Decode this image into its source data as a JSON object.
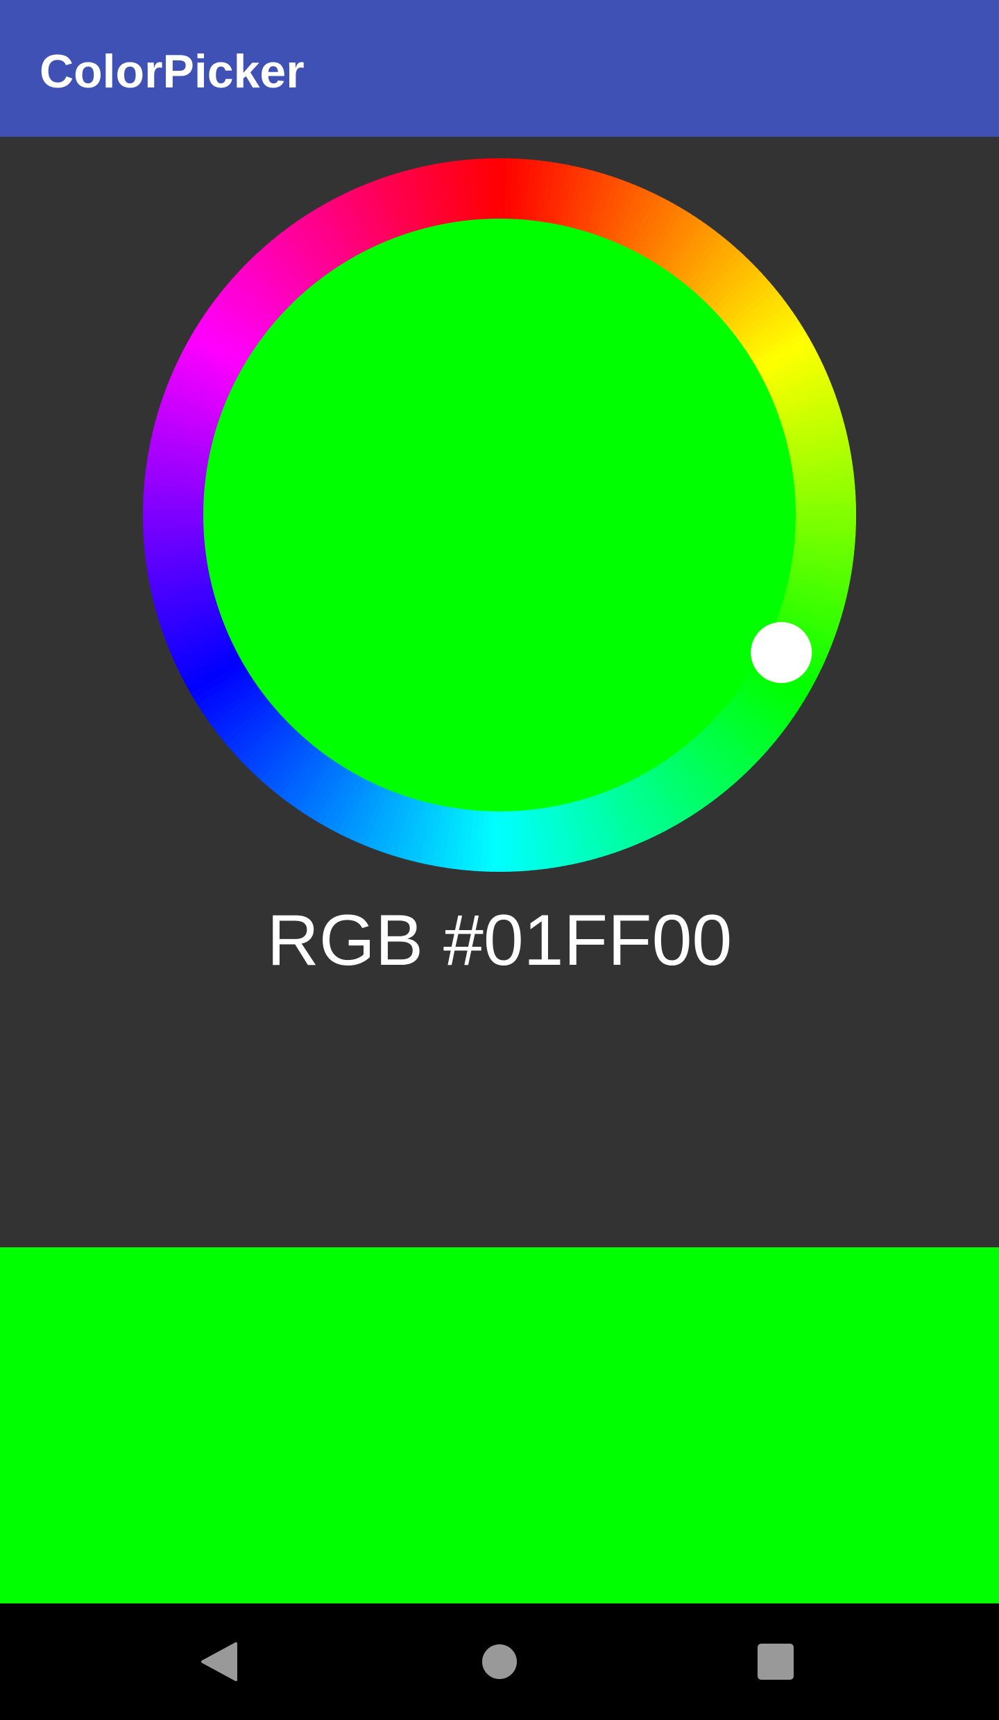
{
  "app_bar": {
    "title": "ColorPicker",
    "background": "#3F51B5"
  },
  "color_picker": {
    "selected_color": "#00FF00",
    "hue_degrees": 120,
    "hex_label": "RGB #01FF00",
    "ring_hues": [
      "#FF0000",
      "#FFFF00",
      "#00FF00",
      "#00FFFF",
      "#0000FF",
      "#FF00FF"
    ],
    "thumb_color": "#FFFFFF"
  },
  "preview": {
    "color": "#00FF00"
  },
  "navigation_bar": {
    "background": "#000000",
    "icon_color": "#999999",
    "buttons": [
      "back-icon",
      "home-icon",
      "recents-icon"
    ]
  }
}
